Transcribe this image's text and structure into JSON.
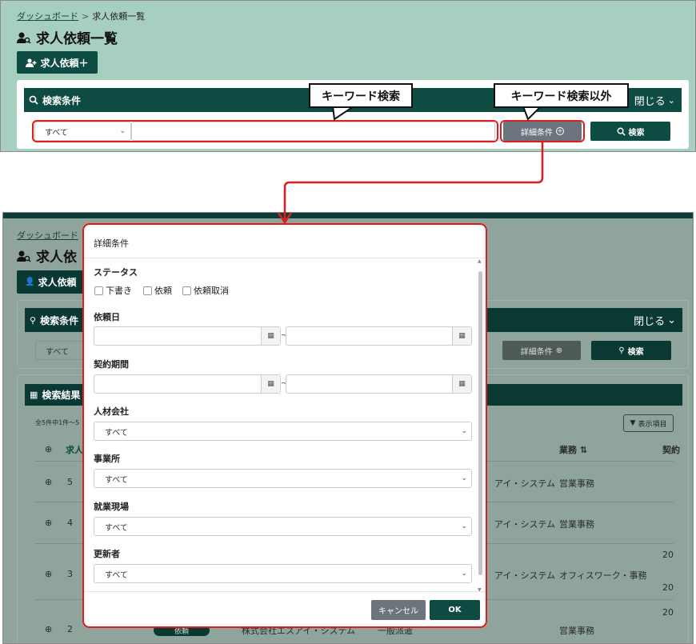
{
  "top": {
    "breadcrumb": {
      "home": "ダッシュボード",
      "separator": ">",
      "current": "求人依頼一覧"
    },
    "page_title": "求人依頼一覧",
    "add_button": "求人依頼＋",
    "search_panel": {
      "title": "検索条件",
      "close_label": "閉じる",
      "select_value": "すべて",
      "keyword_placeholder": "",
      "detail_button": "詳細条件",
      "search_button": "検索"
    },
    "callouts": {
      "keyword": "キーワード検索",
      "other": "キーワード検索以外"
    }
  },
  "bottom_bg": {
    "breadcrumb": {
      "home": "ダッシュボード"
    },
    "page_title": "求人依",
    "add_button": "求人依頼",
    "search_title": "検索条件",
    "close_label": "閉じる",
    "select_value": "すべて",
    "detail_button": "詳細条件",
    "search_button": "検索",
    "results_title": "検索結果",
    "result_count": "全5件中1件～5",
    "display_items_button": "表示項目",
    "col_id": "求人",
    "col_work": "業務",
    "col_contract": "契約",
    "rows": [
      {
        "id": "5",
        "company": "アイ・システム",
        "work": "営業事務",
        "c1": "",
        "c2": ""
      },
      {
        "id": "4",
        "company": "アイ・システム",
        "work": "営業事務",
        "c1": "",
        "c2": ""
      },
      {
        "id": "3",
        "company": "アイ・システム",
        "work": "オフィスワーク・事務",
        "c1": "20",
        "c2": "20"
      },
      {
        "id": "2",
        "company": "アイ・システム",
        "work": "営業事務",
        "c1": "20",
        "c2": ""
      }
    ],
    "row2_partial": {
      "status": "依頼",
      "company_full": "株式会社エスアイ・システム",
      "dispatch": "一般派遣"
    }
  },
  "modal": {
    "title": "詳細条件",
    "status_label": "ステータス",
    "status_options": [
      "下書き",
      "依頼",
      "依頼取消"
    ],
    "request_date_label": "依頼日",
    "contract_period_label": "契約期間",
    "tilde": "~",
    "agency_label": "人材会社",
    "agency_value": "すべて",
    "office_label": "事業所",
    "office_value": "すべて",
    "site_label": "就業現場",
    "site_value": "すべて",
    "updater_label": "更新者",
    "updater_value": "すべて",
    "cancel_button": "キャンセル",
    "ok_button": "OK"
  },
  "colors": {
    "brand": "#0d4b43",
    "highlight": "#e01c1c",
    "gray_button": "#6c757d"
  }
}
